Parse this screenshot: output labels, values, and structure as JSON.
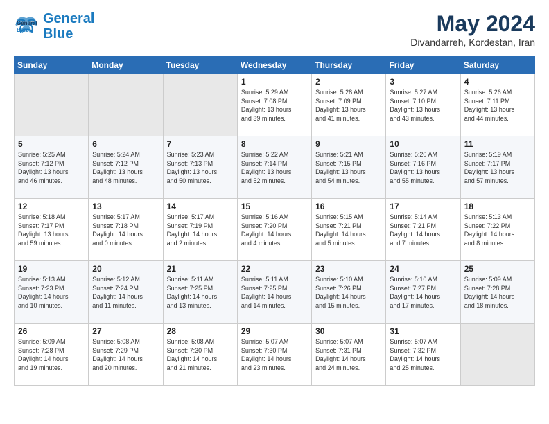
{
  "logo": {
    "line1": "General",
    "line2": "Blue"
  },
  "title": "May 2024",
  "subtitle": "Divandarreh, Kordestan, Iran",
  "weekdays": [
    "Sunday",
    "Monday",
    "Tuesday",
    "Wednesday",
    "Thursday",
    "Friday",
    "Saturday"
  ],
  "weeks": [
    [
      {
        "day": "",
        "info": ""
      },
      {
        "day": "",
        "info": ""
      },
      {
        "day": "",
        "info": ""
      },
      {
        "day": "1",
        "info": "Sunrise: 5:29 AM\nSunset: 7:08 PM\nDaylight: 13 hours\nand 39 minutes."
      },
      {
        "day": "2",
        "info": "Sunrise: 5:28 AM\nSunset: 7:09 PM\nDaylight: 13 hours\nand 41 minutes."
      },
      {
        "day": "3",
        "info": "Sunrise: 5:27 AM\nSunset: 7:10 PM\nDaylight: 13 hours\nand 43 minutes."
      },
      {
        "day": "4",
        "info": "Sunrise: 5:26 AM\nSunset: 7:11 PM\nDaylight: 13 hours\nand 44 minutes."
      }
    ],
    [
      {
        "day": "5",
        "info": "Sunrise: 5:25 AM\nSunset: 7:12 PM\nDaylight: 13 hours\nand 46 minutes."
      },
      {
        "day": "6",
        "info": "Sunrise: 5:24 AM\nSunset: 7:12 PM\nDaylight: 13 hours\nand 48 minutes."
      },
      {
        "day": "7",
        "info": "Sunrise: 5:23 AM\nSunset: 7:13 PM\nDaylight: 13 hours\nand 50 minutes."
      },
      {
        "day": "8",
        "info": "Sunrise: 5:22 AM\nSunset: 7:14 PM\nDaylight: 13 hours\nand 52 minutes."
      },
      {
        "day": "9",
        "info": "Sunrise: 5:21 AM\nSunset: 7:15 PM\nDaylight: 13 hours\nand 54 minutes."
      },
      {
        "day": "10",
        "info": "Sunrise: 5:20 AM\nSunset: 7:16 PM\nDaylight: 13 hours\nand 55 minutes."
      },
      {
        "day": "11",
        "info": "Sunrise: 5:19 AM\nSunset: 7:17 PM\nDaylight: 13 hours\nand 57 minutes."
      }
    ],
    [
      {
        "day": "12",
        "info": "Sunrise: 5:18 AM\nSunset: 7:17 PM\nDaylight: 13 hours\nand 59 minutes."
      },
      {
        "day": "13",
        "info": "Sunrise: 5:17 AM\nSunset: 7:18 PM\nDaylight: 14 hours\nand 0 minutes."
      },
      {
        "day": "14",
        "info": "Sunrise: 5:17 AM\nSunset: 7:19 PM\nDaylight: 14 hours\nand 2 minutes."
      },
      {
        "day": "15",
        "info": "Sunrise: 5:16 AM\nSunset: 7:20 PM\nDaylight: 14 hours\nand 4 minutes."
      },
      {
        "day": "16",
        "info": "Sunrise: 5:15 AM\nSunset: 7:21 PM\nDaylight: 14 hours\nand 5 minutes."
      },
      {
        "day": "17",
        "info": "Sunrise: 5:14 AM\nSunset: 7:21 PM\nDaylight: 14 hours\nand 7 minutes."
      },
      {
        "day": "18",
        "info": "Sunrise: 5:13 AM\nSunset: 7:22 PM\nDaylight: 14 hours\nand 8 minutes."
      }
    ],
    [
      {
        "day": "19",
        "info": "Sunrise: 5:13 AM\nSunset: 7:23 PM\nDaylight: 14 hours\nand 10 minutes."
      },
      {
        "day": "20",
        "info": "Sunrise: 5:12 AM\nSunset: 7:24 PM\nDaylight: 14 hours\nand 11 minutes."
      },
      {
        "day": "21",
        "info": "Sunrise: 5:11 AM\nSunset: 7:25 PM\nDaylight: 14 hours\nand 13 minutes."
      },
      {
        "day": "22",
        "info": "Sunrise: 5:11 AM\nSunset: 7:25 PM\nDaylight: 14 hours\nand 14 minutes."
      },
      {
        "day": "23",
        "info": "Sunrise: 5:10 AM\nSunset: 7:26 PM\nDaylight: 14 hours\nand 15 minutes."
      },
      {
        "day": "24",
        "info": "Sunrise: 5:10 AM\nSunset: 7:27 PM\nDaylight: 14 hours\nand 17 minutes."
      },
      {
        "day": "25",
        "info": "Sunrise: 5:09 AM\nSunset: 7:28 PM\nDaylight: 14 hours\nand 18 minutes."
      }
    ],
    [
      {
        "day": "26",
        "info": "Sunrise: 5:09 AM\nSunset: 7:28 PM\nDaylight: 14 hours\nand 19 minutes."
      },
      {
        "day": "27",
        "info": "Sunrise: 5:08 AM\nSunset: 7:29 PM\nDaylight: 14 hours\nand 20 minutes."
      },
      {
        "day": "28",
        "info": "Sunrise: 5:08 AM\nSunset: 7:30 PM\nDaylight: 14 hours\nand 21 minutes."
      },
      {
        "day": "29",
        "info": "Sunrise: 5:07 AM\nSunset: 7:30 PM\nDaylight: 14 hours\nand 23 minutes."
      },
      {
        "day": "30",
        "info": "Sunrise: 5:07 AM\nSunset: 7:31 PM\nDaylight: 14 hours\nand 24 minutes."
      },
      {
        "day": "31",
        "info": "Sunrise: 5:07 AM\nSunset: 7:32 PM\nDaylight: 14 hours\nand 25 minutes."
      },
      {
        "day": "",
        "info": ""
      }
    ]
  ]
}
